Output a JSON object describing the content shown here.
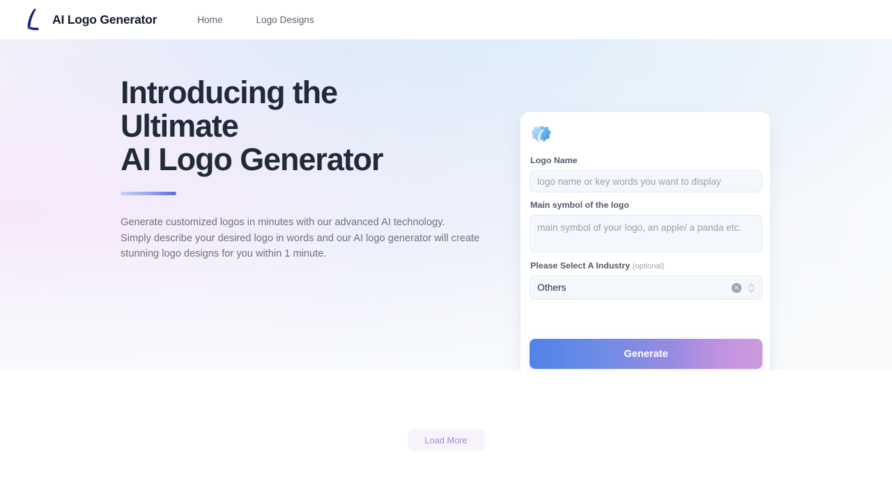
{
  "header": {
    "logo_icon": "stylized-l-logo-icon",
    "brand_name": "AI Logo Generator",
    "nav": [
      {
        "label": "Home",
        "name": "nav-link-home"
      },
      {
        "label": "Logo Designs",
        "name": "nav-link-logo-designs"
      }
    ]
  },
  "hero": {
    "title_lines": [
      "Introducing the",
      "Ultimate",
      "AI Logo Generator"
    ],
    "description_lines": [
      "Generate customized logos in minutes with our advanced AI technology.",
      "Simply describe your desired logo in words and our AI logo generator will create",
      "stunning logo designs for you within 1 minute."
    ]
  },
  "form": {
    "card_icon": "blue-gem-icon",
    "logo_name": {
      "label": "Logo Name",
      "value": "",
      "placeholder": "logo name or key words you want to display"
    },
    "main_symbol": {
      "label": "Main symbol of the logo",
      "value": "",
      "placeholder": "main symbol of your logo, an apple/ a panda etc."
    },
    "industry": {
      "label": "Please Select A Industry",
      "optional_tag": "(optional)",
      "selected": "Others",
      "clear_icon": "clear-circle-icon",
      "stepper_icon": "chevron-up-down-icon"
    },
    "generate_label": "Generate"
  },
  "gallery": {
    "load_more_label": "Load More"
  },
  "colors": {
    "brand_navy": "#1a237e",
    "heading": "#222a39",
    "body_text": "#6b7280",
    "accent_bar_start": "#c8cdf2",
    "accent_bar_end": "#5b6ae0",
    "generate_gradient_start": "#4f83e8",
    "generate_gradient_end": "#cb9add",
    "load_more_bg": "#f7f3fc",
    "load_more_text": "#a58ad6",
    "input_bg": "#f4f7fb",
    "input_border": "#e4ebf5"
  }
}
